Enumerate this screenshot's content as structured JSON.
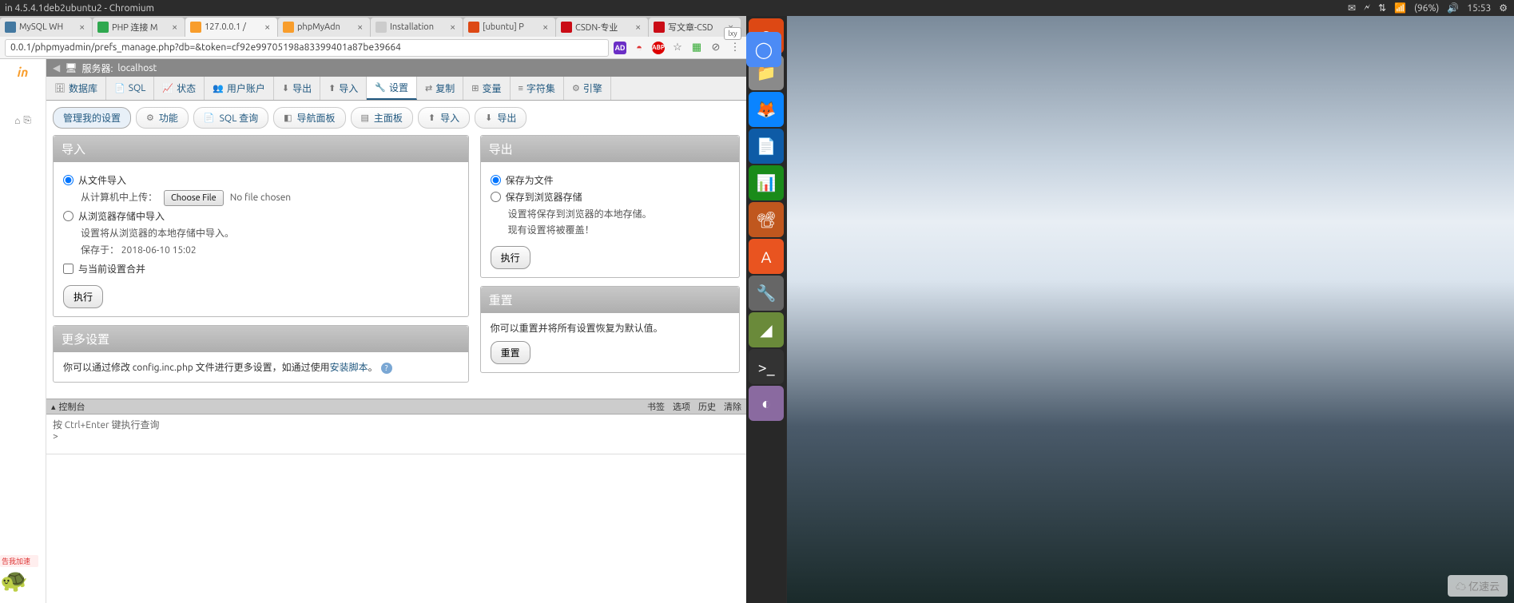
{
  "ubuntu": {
    "window_title": "in 4.5.4.1deb2ubuntu2 - Chromium",
    "battery": "(96%)",
    "time": "15:53"
  },
  "browser": {
    "tabs": [
      {
        "label": "MySQL WH",
        "favicon": "#4479a1"
      },
      {
        "label": "PHP 连接 M",
        "favicon": "#2fa84f"
      },
      {
        "label": "127.0.0.1 /",
        "favicon": "#f89d2c",
        "active": true
      },
      {
        "label": "phpMyAdn",
        "favicon": "#f89d2c"
      },
      {
        "label": "Installation",
        "favicon": "#ccc"
      },
      {
        "label": "[ubuntu] P",
        "favicon": "#dd4814"
      },
      {
        "label": "CSDN-专业",
        "favicon": "#ca0c16"
      },
      {
        "label": "写文章-CSD",
        "favicon": "#ca0c16"
      }
    ],
    "url": "0.0.1/phpmyadmin/prefs_manage.php?db=&token=cf92e99705198a83399401a87be39664",
    "ext_ad": "AD",
    "ext_abp": "ABP",
    "corner": "lxy"
  },
  "pma": {
    "logo": "in",
    "server_label": "服务器:",
    "server_name": "localhost",
    "tabs": {
      "database": "数据库",
      "sql": "SQL",
      "status": "状态",
      "users": "用户账户",
      "export": "导出",
      "import": "导入",
      "settings": "设置",
      "replication": "复制",
      "variables": "变量",
      "charset": "字符集",
      "engine": "引擎"
    },
    "subbtns": {
      "manage": "管理我的设置",
      "features": "功能",
      "sql_query": "SQL 查询",
      "nav": "导航面板",
      "main": "主面板",
      "import": "导入",
      "export": "导出"
    },
    "import_panel": {
      "title": "导入",
      "from_file": "从文件导入",
      "upload_label": "从计算机中上传：",
      "choose_file": "Choose File",
      "no_file": "No file chosen",
      "from_storage": "从浏览器存储中导入",
      "storage_desc": "设置将从浏览器的本地存储中导入。",
      "saved_at_label": "保存于：",
      "saved_at_value": "2018-06-10 15:02",
      "merge": "与当前设置合并",
      "exec": "执行"
    },
    "export_panel": {
      "title": "导出",
      "as_file": "保存为文件",
      "to_storage": "保存到浏览器存储",
      "desc1": "设置将保存到浏览器的本地存储。",
      "desc2": "现有设置将被覆盖！",
      "exec": "执行"
    },
    "reset_panel": {
      "title": "重置",
      "desc": "你可以重置并将所有设置恢复为默认值。",
      "btn": "重置"
    },
    "more_panel": {
      "title": "更多设置",
      "desc_pre": "你可以通过修改 config.inc.php 文件进行更多设置，如通过使用",
      "desc_link": "安装脚本",
      "desc_post": "。"
    },
    "console": {
      "label": "控制台",
      "bookmarks": "书签",
      "options": "选项",
      "history": "历史",
      "clear": "清除",
      "hint": "按  Ctrl+Enter  键执行查询",
      "prompt": ">"
    }
  },
  "sticker": "告我加速",
  "watermark": "亿速云"
}
